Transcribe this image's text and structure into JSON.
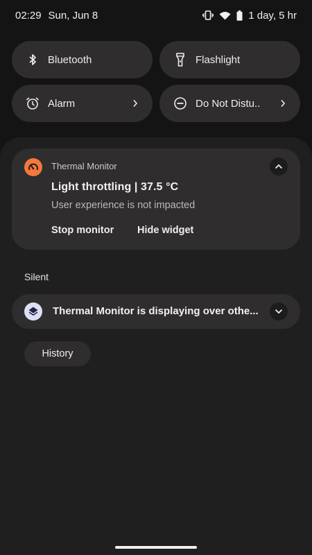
{
  "status_bar": {
    "time": "02:29",
    "date": "Sun, Jun 8",
    "battery_text": "1 day, 5 hr",
    "icons": [
      "vibrate-icon",
      "wifi-icon",
      "battery-icon"
    ]
  },
  "quick_tiles": [
    {
      "label": "Bluetooth",
      "icon": "bluetooth-icon"
    },
    {
      "label": "Flashlight",
      "icon": "flashlight-icon"
    },
    {
      "label": "Alarm",
      "icon": "alarm-icon",
      "chevron": true
    },
    {
      "label": "Do Not Distu..",
      "icon": "do-not-disturb-icon",
      "chevron": true
    }
  ],
  "notification": {
    "app_name": "Thermal Monitor",
    "title": "Light throttling | 37.5 °C",
    "body": "User experience is not impacted",
    "actions": [
      "Stop monitor",
      "Hide widget"
    ],
    "app_icon_color": "#f2783d"
  },
  "silent_section": {
    "label": "Silent",
    "item_text": "Thermal Monitor is displaying over othe..."
  },
  "history_button": "History",
  "colors": {
    "background": "#141414",
    "shade": "#201f20",
    "card": "#2f2d2e",
    "accent": "#f2783d"
  }
}
